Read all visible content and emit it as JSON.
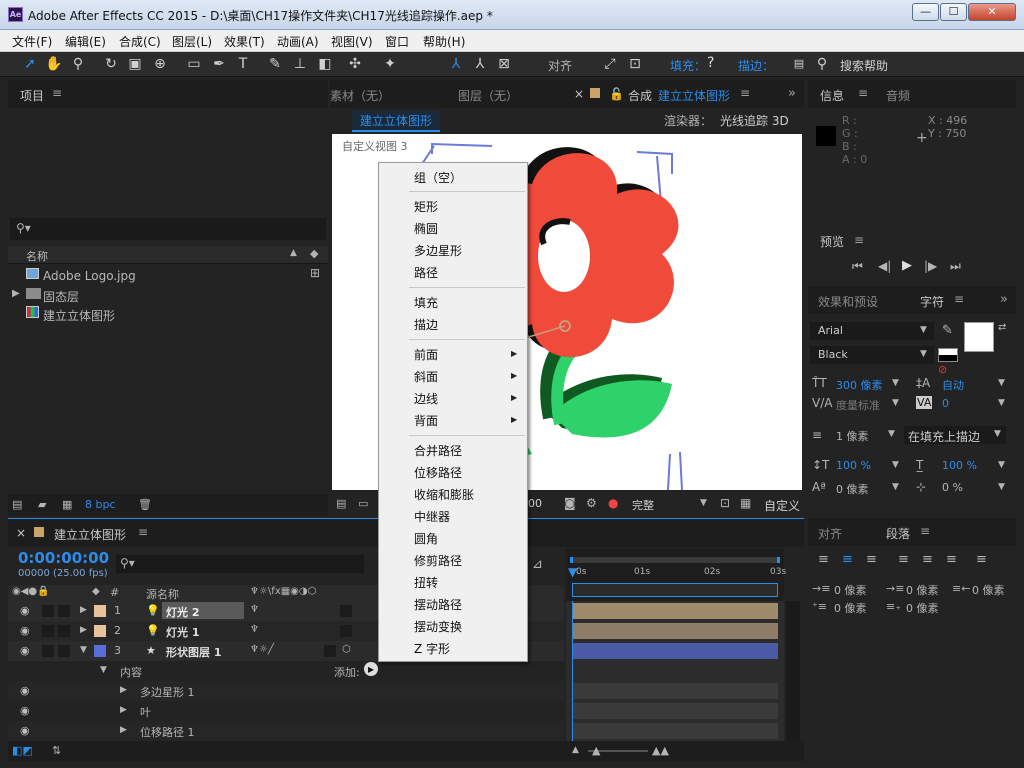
{
  "window": {
    "title": "Adobe After Effects CC 2015 - D:\\桌面\\CH17操作文件夹\\CH17光线追踪操作.aep *",
    "logo": "Ae",
    "minimize": "—",
    "maximize": "☐",
    "close": "✕"
  },
  "menu": [
    "文件(F)",
    "编辑(E)",
    "合成(C)",
    "图层(L)",
    "效果(T)",
    "动画(A)",
    "视图(V)",
    "窗口",
    "帮助(H)"
  ],
  "toolbar": {
    "align_label": "对齐",
    "fill_label": "填充：",
    "fill_value": "?",
    "stroke_label": "描边：",
    "search_help": "搜索帮助"
  },
  "project": {
    "title": "项目",
    "search_placeholder": "",
    "col_name": "名称",
    "items": [
      {
        "name": "Adobe Logo.jpg",
        "icon": "image-icon"
      },
      {
        "name": "固态层",
        "icon": "folder-icon"
      },
      {
        "name": "建立立体图形",
        "icon": "composition-icon"
      }
    ],
    "bpc": "8 bpc"
  },
  "viewer": {
    "tabs": [
      "素材（无）",
      "图层（无）"
    ],
    "comp_tab_label": "合成",
    "comp_name": "建立立体图形",
    "breadcrumb": "建立立体图形",
    "renderer_label": "渲染器：",
    "renderer_value": "光线追踪 3D",
    "view_label": "自定义视图 3",
    "timecode": "00",
    "quality": "完整",
    "view_dropdown": "自定义"
  },
  "context_menu": {
    "groups": [
      [
        {
          "label": "组（空）"
        }
      ],
      [
        {
          "label": "矩形"
        },
        {
          "label": "椭圆"
        },
        {
          "label": "多边星形"
        },
        {
          "label": "路径"
        }
      ],
      [
        {
          "label": "填充"
        },
        {
          "label": "描边"
        }
      ],
      [
        {
          "label": "前面",
          "submenu": true
        },
        {
          "label": "斜面",
          "submenu": true
        },
        {
          "label": "边线",
          "submenu": true
        },
        {
          "label": "背面",
          "submenu": true
        }
      ],
      [
        {
          "label": "合并路径"
        },
        {
          "label": "位移路径"
        },
        {
          "label": "收缩和膨胀"
        },
        {
          "label": "中继器"
        },
        {
          "label": "圆角"
        },
        {
          "label": "修剪路径"
        },
        {
          "label": "扭转"
        },
        {
          "label": "摆动路径"
        },
        {
          "label": "摆动变换"
        },
        {
          "label": "Z 字形"
        }
      ]
    ]
  },
  "info": {
    "tabs": [
      "信息",
      "音频"
    ],
    "r": "R :",
    "g": "G :",
    "b": "B :",
    "a": "A : 0",
    "x": "X : 496",
    "y": "Y : 750"
  },
  "preview": {
    "title": "预览"
  },
  "character": {
    "tabs": [
      "效果和预设",
      "字符"
    ],
    "font": "Arial",
    "style": "Black",
    "size": "300 像素",
    "leading": "自动",
    "kerning_label": "度量标准",
    "tracking": "0",
    "stroke_width": "1 像素",
    "stroke_mode": "在填充上描边",
    "v_scale": "100 %",
    "h_scale": "100 %",
    "baseline": "0 像素",
    "tsume": "0 %"
  },
  "paragraph": {
    "tabs": [
      "对齐",
      "段落"
    ],
    "indent1": "0 像素",
    "indent2": "0 像素",
    "indent3": "0 像素",
    "space1": "0 像素",
    "space2": "0 像素"
  },
  "timeline": {
    "comp_name": "建立立体图形",
    "timecode": "0:00:00:00",
    "frames": "00000 (25.00 fps)",
    "col_hash": "#",
    "col_source": "源名称",
    "ruler": [
      "0s",
      "01s",
      "02s",
      "03s"
    ],
    "layers": [
      {
        "num": "1",
        "name": "灯光 2",
        "color": "#e8c29a",
        "track": "#a08a6c"
      },
      {
        "num": "2",
        "name": "灯光 1",
        "color": "#e8c29a",
        "track": "#8f7c66"
      },
      {
        "num": "3",
        "name": "形状图层 1",
        "color": "#5a6fd6",
        "track": "#4a5aa5"
      }
    ],
    "contents_label": "内容",
    "add_label": "添加:",
    "sublayers": [
      "多边星形 1",
      "叶",
      "位移路径 1"
    ]
  },
  "colors": {
    "accent": "#2d8ceb",
    "flower": "#f04a3a",
    "leaf": "#2fd16a"
  }
}
